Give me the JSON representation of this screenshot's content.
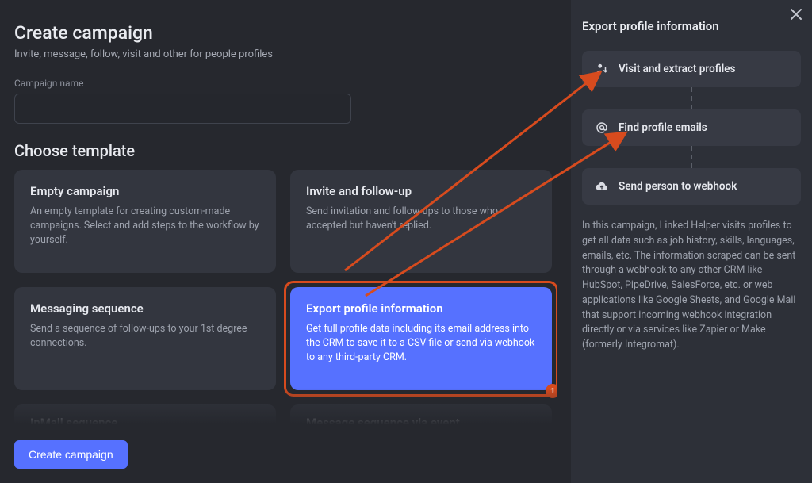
{
  "page": {
    "title": "Create campaign",
    "subtitle": "Invite, message, follow, visit and other for people profiles",
    "campaign_name_label": "Campaign name",
    "campaign_name_value": "",
    "campaign_name_placeholder": "",
    "choose_template_label": "Choose template",
    "create_button": "Create campaign",
    "annotation_badge": "1"
  },
  "templates": {
    "empty": {
      "title": "Empty campaign",
      "desc": "An empty template for creating custom-made campaigns. Select and add steps to the workflow by yourself."
    },
    "invite": {
      "title": "Invite and follow-up",
      "desc": "Send invitation and follow-ups to those who accepted but haven't replied."
    },
    "messaging": {
      "title": "Messaging sequence",
      "desc": "Send a sequence of follow-ups to your 1st degree connections."
    },
    "export": {
      "title": "Export profile information",
      "desc": "Get full profile data including its email address into the CRM to save it to a CSV file or send via webhook to any third-party CRM."
    },
    "inmail": {
      "title": "InMail sequence"
    },
    "msgevent": {
      "title": "Message sequence via event"
    }
  },
  "side": {
    "title": "Export profile information",
    "steps": {
      "visit": "Visit and extract profiles",
      "emails": "Find profile emails",
      "webhook": "Send person to webhook"
    },
    "description": "In this campaign, Linked Helper visits profiles to get all data such as job history, skills, languages, emails, etc. The information scraped can be sent through a webhook to any other CRM like HubSpot, PipeDrive, SalesForce, etc. or web applications like Google Sheets, and Google Mail that support incoming webhook integration directly or via services like Zapier or Make (formerly Integromat)."
  }
}
